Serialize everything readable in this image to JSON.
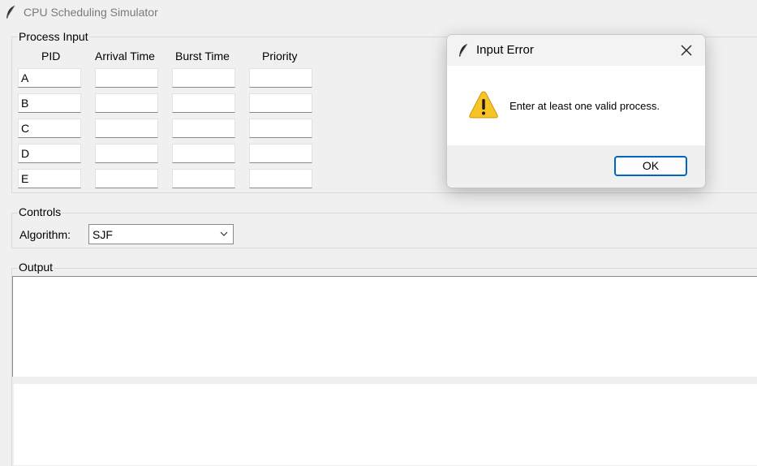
{
  "window": {
    "title": "CPU Scheduling Simulator"
  },
  "process_input": {
    "label": "Process Input",
    "columns": [
      "PID",
      "Arrival Time",
      "Burst Time",
      "Priority"
    ],
    "rows": [
      {
        "pid": "A",
        "arrival": "",
        "burst": "",
        "priority": ""
      },
      {
        "pid": "B",
        "arrival": "",
        "burst": "",
        "priority": ""
      },
      {
        "pid": "C",
        "arrival": "",
        "burst": "",
        "priority": ""
      },
      {
        "pid": "D",
        "arrival": "",
        "burst": "",
        "priority": ""
      },
      {
        "pid": "E",
        "arrival": "",
        "burst": "",
        "priority": ""
      }
    ]
  },
  "controls": {
    "label": "Controls",
    "algorithm_label": "Algorithm:",
    "algorithm_value": "SJF"
  },
  "output": {
    "label": "Output"
  },
  "dialog": {
    "title": "Input Error",
    "message": "Enter at least one valid process.",
    "ok_label": "OK",
    "icon": "warning-icon"
  },
  "colors": {
    "background": "#f0f0f0",
    "accent": "#0067c0",
    "warning": "#f7c325"
  }
}
